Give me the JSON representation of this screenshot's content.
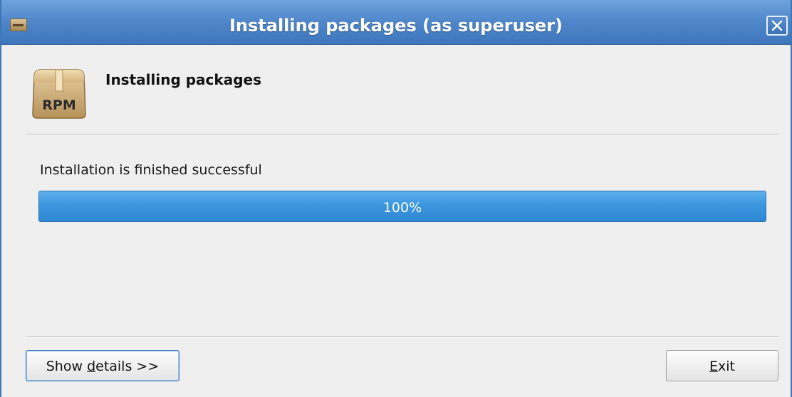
{
  "window": {
    "title": "Installing packages (as superuser)",
    "icon": "rpm-package-icon",
    "close_icon": "close-icon"
  },
  "header": {
    "icon": "rpm-package-icon",
    "icon_text": "RPM",
    "title": "Installing packages"
  },
  "status": {
    "message": "Installation is finished successful"
  },
  "progress": {
    "value": 100,
    "label": "100%",
    "color": "#3b97df"
  },
  "buttons": {
    "details": {
      "prefix": "Show ",
      "mnemonic": "d",
      "suffix": "etails >>"
    },
    "exit": {
      "mnemonic": "E",
      "suffix": "xit"
    }
  }
}
